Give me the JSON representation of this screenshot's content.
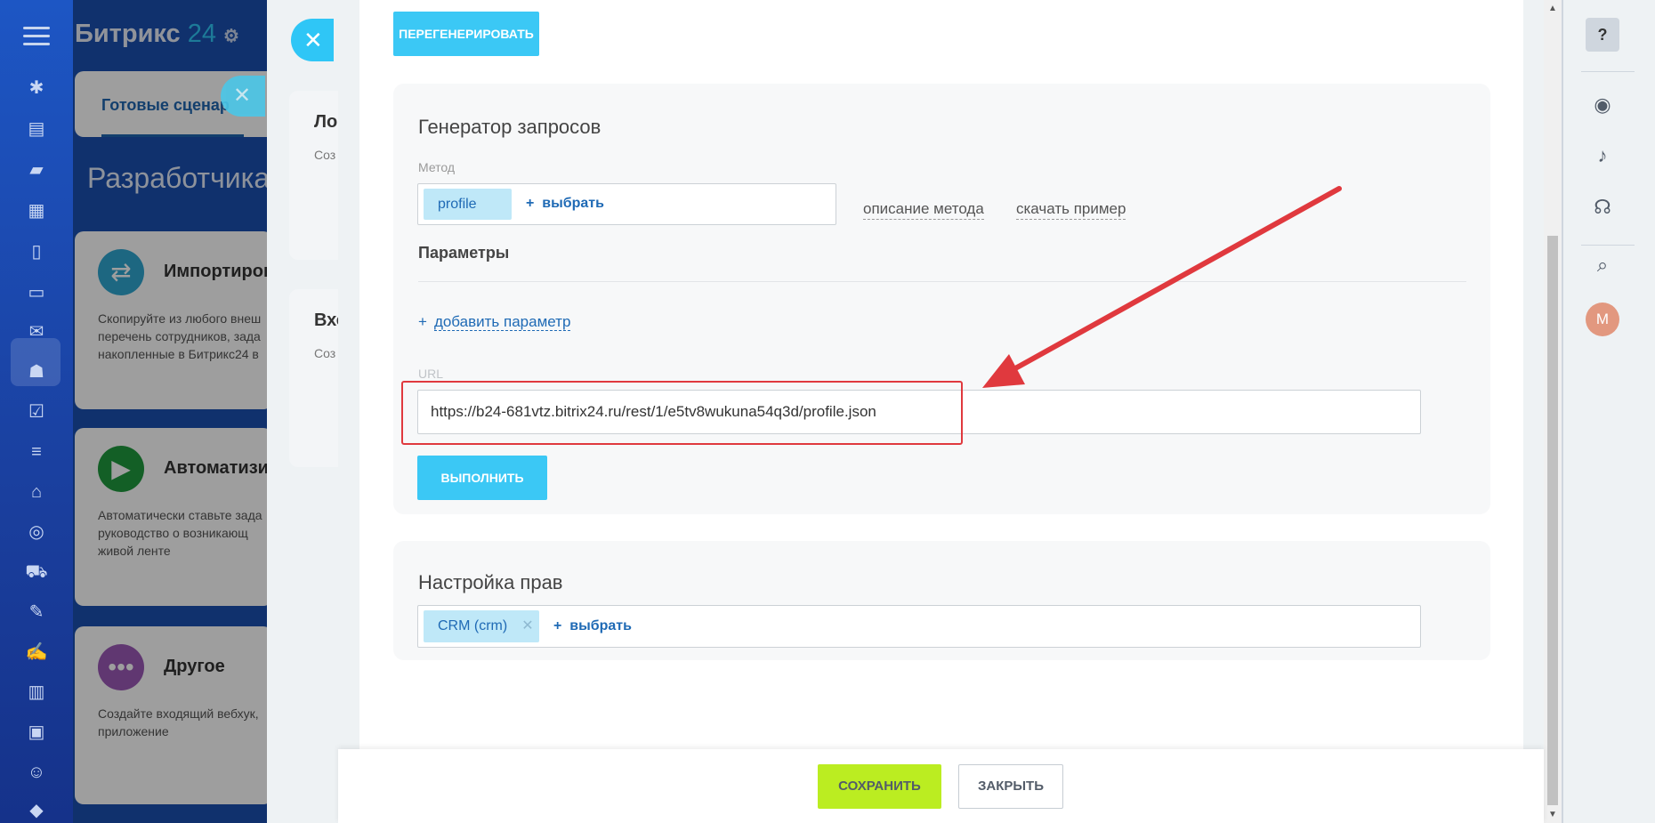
{
  "brand": {
    "name": "Битрикс",
    "num": "24"
  },
  "bg_app": {
    "tab_label": "Готовые сценар",
    "page_title": "Разработчикам",
    "cards": [
      {
        "title": "Импортиров",
        "text": "Скопируйте из любого внеш перечень сотрудников, зада накопленные в Битрикс24 в",
        "icon": "swap-icon",
        "color": "#2fa6d1"
      },
      {
        "title": "Автоматизир",
        "text": "Автоматически ставьте зада руководство о возникающ живой ленте",
        "icon": "play-icon",
        "color": "#1f9a3e"
      },
      {
        "title": "Другое",
        "text": "Создайте входящий вебхук, приложение",
        "icon": "more-icon",
        "color": "#9b59b6"
      }
    ],
    "side_cards": [
      {
        "title": "Ло",
        "text": "Соз"
      },
      {
        "title": "Вхо",
        "text": "Соз"
      }
    ]
  },
  "slider": {
    "regenerate_label": "ПЕРЕГЕНЕРИРОВАТЬ",
    "request_generator": {
      "title": "Генератор запросов",
      "method_label": "Метод",
      "method_value": "profile",
      "select_label": "выбрать",
      "method_desc_link": "описание метода",
      "download_link": "скачать пример",
      "params_title": "Параметры",
      "add_param_label": "добавить параметр",
      "url_label": "URL",
      "url_value": "https://b24-681vtz.bitrix24.ru/rest/1/e5tv8wukuna54q3d/profile.json",
      "execute_label": "ВЫПОЛНИТЬ"
    },
    "rights": {
      "title": "Настройка прав",
      "scope_tag": "CRM (crm)",
      "select_label": "выбрать"
    }
  },
  "footer": {
    "save_label": "СОХРАНИТЬ",
    "close_label": "ЗАКРЫТЬ"
  },
  "right_panel": {
    "help": "?",
    "avatar_initial": "M"
  },
  "colors": {
    "accent": "#3bc8f5",
    "save": "#bbed21",
    "highlight": "#e0393e",
    "arrow": "#e0393e"
  }
}
